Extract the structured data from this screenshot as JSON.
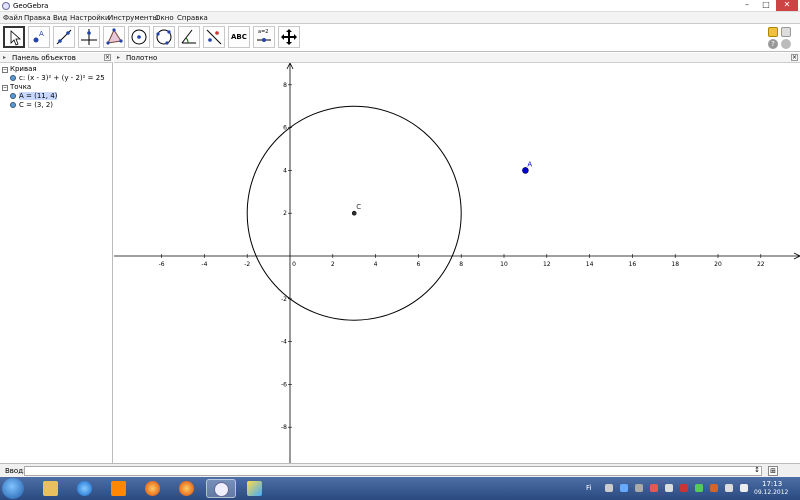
{
  "window": {
    "title": "GeoGebra"
  },
  "menu": [
    "Файл",
    "Правка",
    "Вид",
    "Настройки",
    "Инструменты",
    "Окно",
    "Справка"
  ],
  "toolbar": {
    "tools": [
      "move-tool",
      "point-tool",
      "line-tool",
      "perpendicular-line-tool",
      "polygon-tool",
      "circle-center-point-tool",
      "circle-through-three-points-tool",
      "angle-tool",
      "reflect-tool",
      "text-tool",
      "slider-tool",
      "move-graphics-tool"
    ],
    "text_tool_label": "ABC",
    "slider_tool_label": "a=2"
  },
  "algebra_panel": {
    "title": "Панель объектов",
    "groups": [
      {
        "label": "Кривая",
        "items": [
          {
            "text": "c: (x - 3)² + (y - 2)² = 25",
            "selected": false
          }
        ]
      },
      {
        "label": "Точка",
        "items": [
          {
            "text": "A = (11, 4)",
            "selected": true
          },
          {
            "text": "C = (3, 2)",
            "selected": false
          }
        ]
      }
    ]
  },
  "graphics_panel": {
    "title": "Полотно",
    "x_ticks": [
      "-6",
      "-4",
      "-2",
      "0",
      "2",
      "4",
      "6",
      "8",
      "10",
      "12",
      "14",
      "16",
      "18",
      "20",
      "22"
    ],
    "y_ticks": [
      "8",
      "6",
      "4",
      "2",
      "0",
      "-2",
      "-4",
      "-6",
      "-8"
    ],
    "points": [
      {
        "label": "A",
        "x": 11,
        "y": 4,
        "color": "#0000cc"
      },
      {
        "label": "C",
        "x": 3,
        "y": 2,
        "color": "#333333"
      }
    ],
    "circle": {
      "center": [
        3,
        2
      ],
      "radius": 5
    }
  },
  "input_bar": {
    "label": "Ввод:",
    "value": "",
    "help_button": "↕"
  },
  "taskbar": {
    "clock_time": "17:13",
    "clock_date": "09.12.2012",
    "lang": "Fi"
  },
  "colors": {
    "point_a": "#0000cc",
    "taskbar": "#2a4a80"
  }
}
